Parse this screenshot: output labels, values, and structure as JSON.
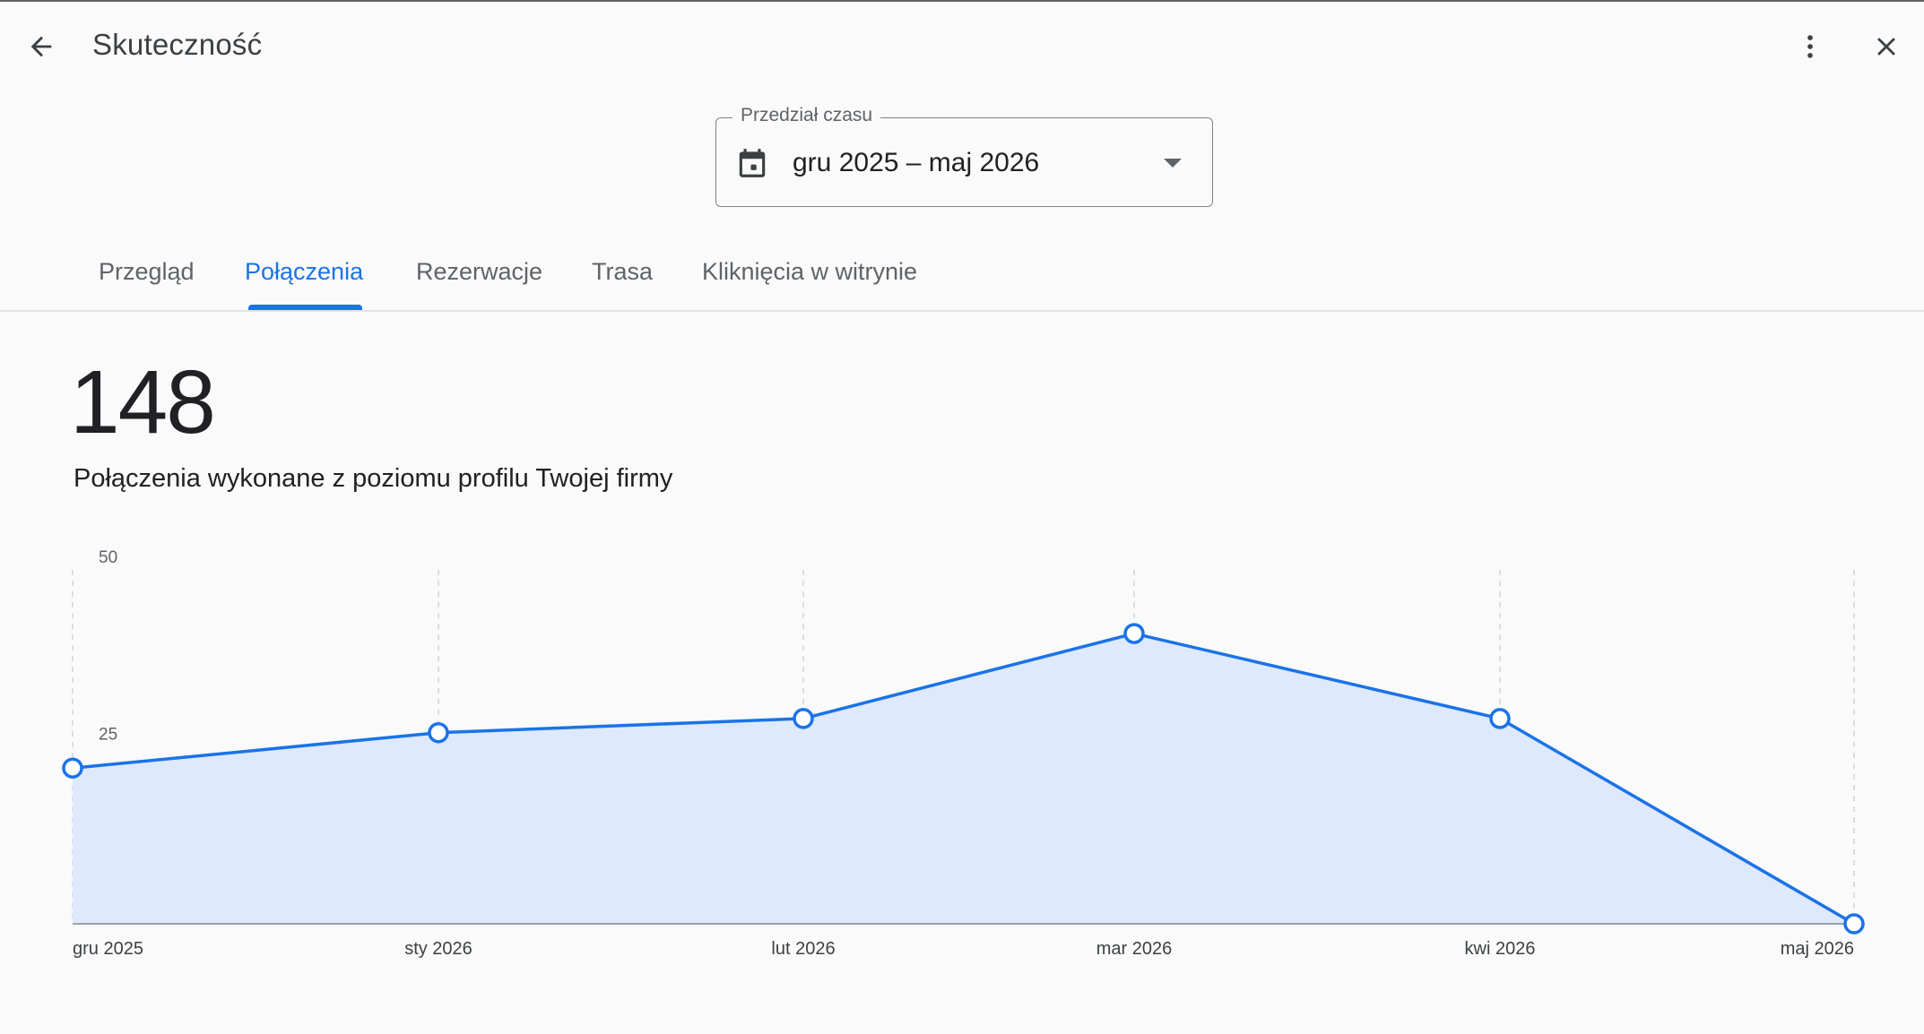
{
  "header": {
    "back_icon": "arrow-back-icon",
    "title": "Skuteczność",
    "more_icon": "more-vert-icon",
    "close_icon": "close-icon"
  },
  "date_range": {
    "label": "Przedział czasu",
    "value": "gru 2025 – maj 2026",
    "calendar_icon": "calendar-icon",
    "dropdown_icon": "arrow-drop-down-icon"
  },
  "tabs": [
    {
      "label": "Przegląd",
      "active": false
    },
    {
      "label": "Połączenia",
      "active": true
    },
    {
      "label": "Rezerwacje",
      "active": false
    },
    {
      "label": "Trasa",
      "active": false
    },
    {
      "label": "Kliknięcia w witrynie",
      "active": false
    }
  ],
  "metric": {
    "value": "148",
    "caption": "Połączenia wykonane z poziomu profilu Twojej firmy"
  },
  "colors": {
    "accent": "#1a73e8",
    "area_fill": "#dfe9fc",
    "gridline": "#d0d3d7",
    "axis": "#9aa0a6"
  },
  "chart_data": {
    "type": "area",
    "categories": [
      "gru 2025",
      "sty 2026",
      "lut 2026",
      "mar 2026",
      "kwi 2026",
      "maj 2026"
    ],
    "values": [
      22,
      27,
      29,
      41,
      29,
      0
    ],
    "ylim": [
      0,
      50
    ],
    "yticks": [
      25,
      50
    ],
    "grid": "vertical dashed"
  }
}
